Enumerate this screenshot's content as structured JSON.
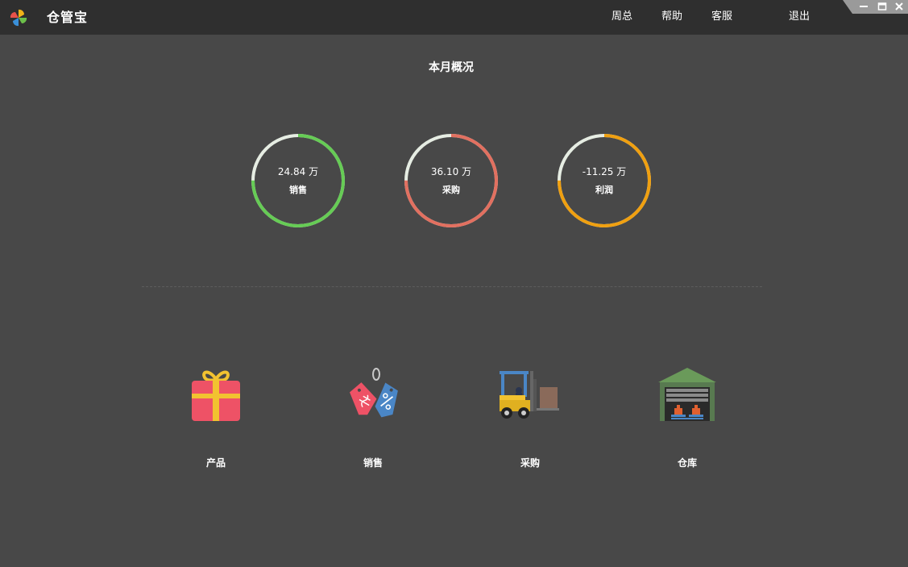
{
  "app": {
    "title": "仓管宝"
  },
  "nav": {
    "weekly": "周总",
    "help": "帮助",
    "service": "客服",
    "logout": "退出"
  },
  "overview": {
    "title": "本月概况",
    "stats": [
      {
        "value": "24.84 万",
        "label": "销售",
        "color": "#66cc55",
        "fill_fraction": 0.75
      },
      {
        "value": "36.10 万",
        "label": "采购",
        "color": "#e27060",
        "fill_fraction": 0.75
      },
      {
        "value": "-11.25 万",
        "label": "利润",
        "color": "#f0a010",
        "fill_fraction": 0.75
      }
    ],
    "ring_track_color": "#e6ede3"
  },
  "modules": [
    {
      "label": "产品",
      "icon": "gift-icon"
    },
    {
      "label": "销售",
      "icon": "sale-tag-icon"
    },
    {
      "label": "采购",
      "icon": "forklift-icon"
    },
    {
      "label": "仓库",
      "icon": "warehouse-icon"
    }
  ],
  "colors": {
    "background": "#484848",
    "titlebar": "#2f2f2f"
  }
}
